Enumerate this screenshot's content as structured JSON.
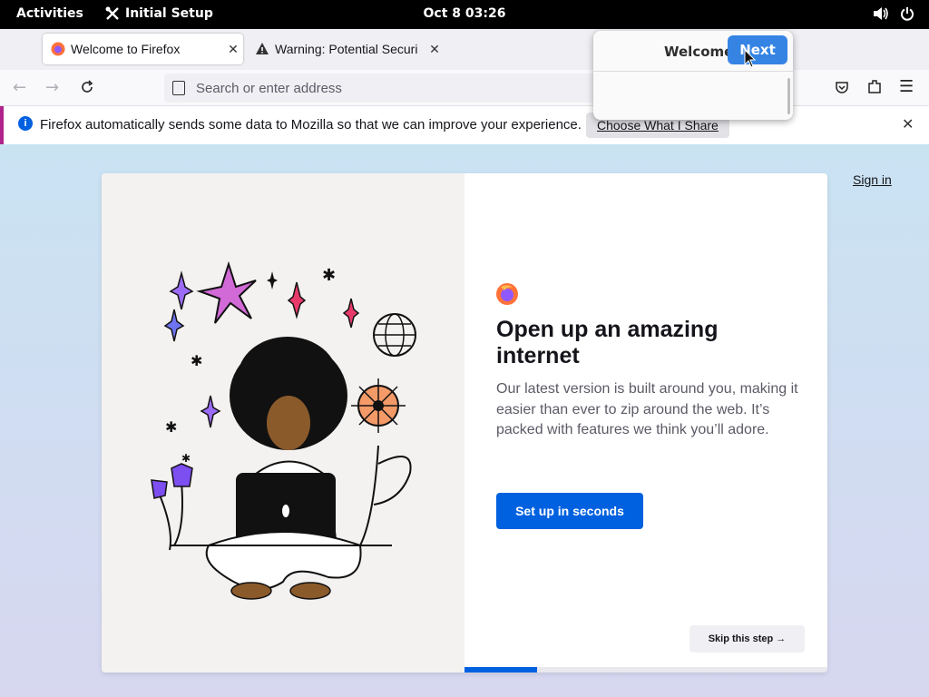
{
  "topbar": {
    "activities": "Activities",
    "app_name": "Initial Setup",
    "clock": "Oct 8  03:26"
  },
  "tabs": [
    {
      "title": "Welcome to Firefox",
      "icon": "firefox-icon",
      "active": true
    },
    {
      "title": "Warning: Potential Securi",
      "icon": "warning-icon",
      "active": false
    }
  ],
  "urlbar": {
    "placeholder": "Search or enter address"
  },
  "notification": {
    "message": "Firefox automatically sends some data to Mozilla so that we can improve your experience.",
    "button": "Choose What I Share"
  },
  "welcome": {
    "signin": "Sign in",
    "heading": "Open up an amazing internet",
    "subtitle": "Our latest version is built around you, making it easier than ever to zip around the web. It’s packed with features we think you’ll adore.",
    "primary_button": "Set up in seconds",
    "skip_button": "Skip this step →",
    "progress_fraction": 0.2
  },
  "popover": {
    "title": "Welcome",
    "next": "Next"
  },
  "colors": {
    "accent": "#0061e0",
    "gnome_accent": "#3584e4",
    "notification_border": "#b0238c"
  }
}
